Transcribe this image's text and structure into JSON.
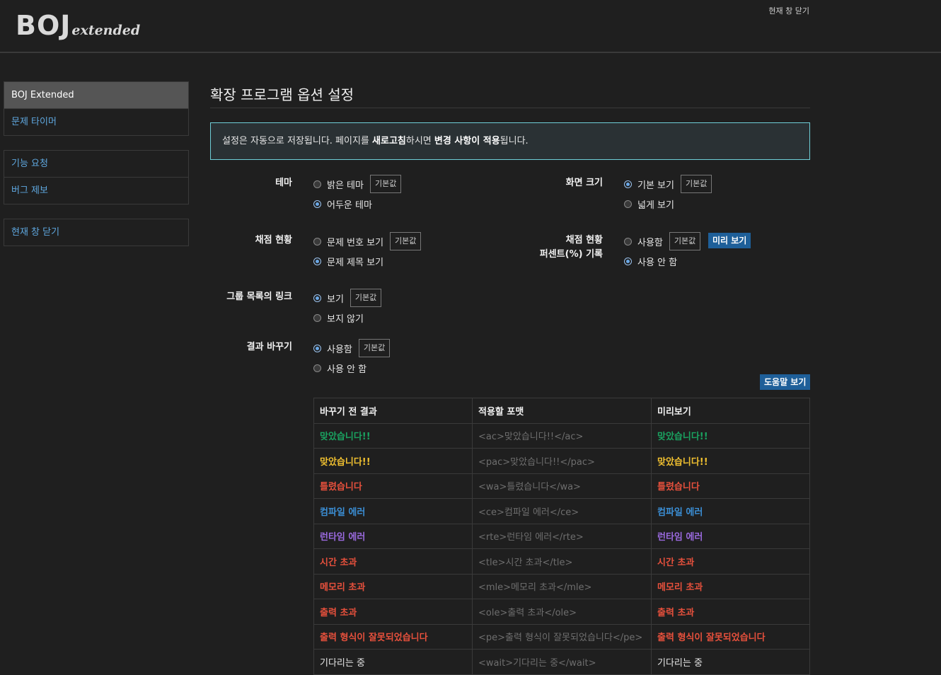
{
  "header": {
    "logo_main": "BOJ",
    "logo_sub": "extended",
    "close_link": "현재 창 닫기"
  },
  "sidebar": {
    "groups": [
      {
        "items": [
          {
            "label": "BOJ Extended"
          },
          {
            "label": "문제 타이머"
          }
        ]
      },
      {
        "items": [
          {
            "label": "기능 요청"
          },
          {
            "label": "버그 제보"
          }
        ]
      },
      {
        "items": [
          {
            "label": "현재 창 닫기"
          }
        ]
      }
    ]
  },
  "main": {
    "title": "확장 프로그램 옵션 설정",
    "notice": {
      "p1": "설정은 자동으로 저장됩니다. 페이지를 ",
      "b1": "새로고침",
      "p2": "하시면 ",
      "b2": "변경 사항이 적용",
      "p3": "됩니다."
    }
  },
  "default_label": "기본값",
  "options": {
    "theme": {
      "label": "테마",
      "opt1": "밝은 테마",
      "opt2": "어두운 테마",
      "selected": "opt2"
    },
    "screen": {
      "label": "화면 크기",
      "opt1": "기본 보기",
      "opt2": "넓게 보기",
      "selected": "opt1"
    },
    "status": {
      "label": "채점 현황",
      "opt1": "문제 번호 보기",
      "opt2": "문제 제목 보기",
      "selected": "opt2"
    },
    "percent": {
      "label1": "채점 현황",
      "label2": "퍼센트(%) 기록",
      "opt1": "사용함",
      "opt2": "사용 안 함",
      "selected": "opt2",
      "preview_button": "미리 보기"
    },
    "group_link": {
      "label": "그룹 목록의 링크",
      "opt1": "보기",
      "opt2": "보지 않기",
      "selected": "opt1"
    },
    "replace": {
      "label": "결과 바꾸기",
      "opt1": "사용함",
      "opt2": "사용 안 함",
      "selected": "opt1",
      "help_button": "도움말 보기"
    }
  },
  "table": {
    "headers": [
      "바꾸기 전 결과",
      "적용할 포맷",
      "미리보기"
    ],
    "rows": [
      {
        "before": "맞았습니다!!",
        "format": "<ac>맞았습니다!!</ac>",
        "preview": "맞았습니다!!",
        "cls": "c-ac"
      },
      {
        "before": "맞았습니다!!",
        "format": "<pac>맞았습니다!!</pac>",
        "preview": "맞았습니다!!",
        "cls": "c-pac"
      },
      {
        "before": "틀렸습니다",
        "format": "<wa>틀렸습니다</wa>",
        "preview": "틀렸습니다",
        "cls": "c-wa"
      },
      {
        "before": "컴파일 에러",
        "format": "<ce>컴파일 에러</ce>",
        "preview": "컴파일 에러",
        "cls": "c-ce"
      },
      {
        "before": "런타임 에러",
        "format": "<rte>런타임 에러</rte>",
        "preview": "런타임 에러",
        "cls": "c-rte"
      },
      {
        "before": "시간 초과",
        "format": "<tle>시간 초과</tle>",
        "preview": "시간 초과",
        "cls": "c-tle"
      },
      {
        "before": "메모리 초과",
        "format": "<mle>메모리 초과</mle>",
        "preview": "메모리 초과",
        "cls": "c-tle"
      },
      {
        "before": "출력 초과",
        "format": "<ole>출력 초과</ole>",
        "preview": "출력 초과",
        "cls": "c-tle"
      },
      {
        "before": "출력 형식이 잘못되었습니다",
        "format": "<pe>출력 형식이 잘못되었습니다</pe>",
        "preview": "출력 형식이 잘못되었습니다",
        "cls": "c-tle"
      },
      {
        "before": "기다리는 중",
        "format": "<wait>기다리는 중</wait>",
        "preview": "기다리는 중",
        "cls": "c-wait"
      }
    ]
  },
  "colors": {
    "accent": "#1e5f99",
    "link": "#5fa8e0",
    "accepted": "#1aa260",
    "partial": "#f0c030",
    "wrong": "#e6503c",
    "compile_error": "#3b8fd6",
    "runtime_error": "#9b6ae0"
  }
}
